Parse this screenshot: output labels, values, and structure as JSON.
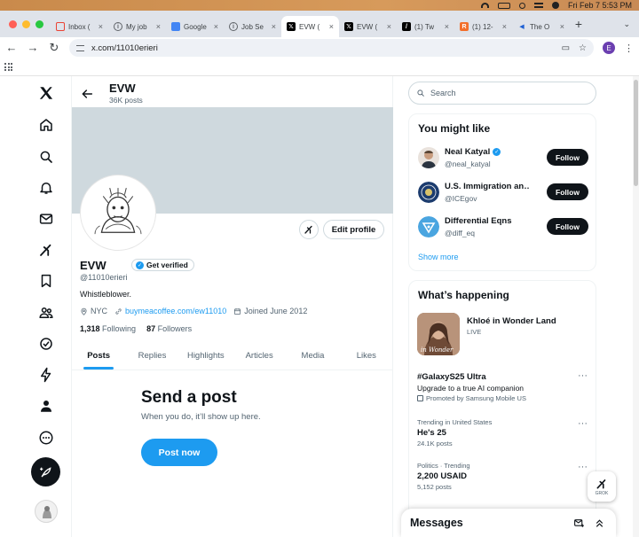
{
  "menubar": {
    "datetime": "Fri Feb 7  5:53 PM"
  },
  "browser": {
    "tabs": [
      {
        "label": "Inbox (",
        "favicon": "gmail-icon"
      },
      {
        "label": "My job",
        "favicon": "info-icon"
      },
      {
        "label": "Google",
        "favicon": "docs-icon"
      },
      {
        "label": "Job Se",
        "favicon": "info-icon"
      },
      {
        "label": "EVW (",
        "favicon": "x-icon"
      },
      {
        "label": "EVW (",
        "favicon": "x-icon"
      },
      {
        "label": "(1) Tw",
        "favicon": "slash-icon"
      },
      {
        "label": "(1) 12-",
        "favicon": "orange-icon"
      },
      {
        "label": "The O",
        "favicon": "blue-icon"
      }
    ],
    "url": "x.com/11010erieri",
    "profile_initial": "E"
  },
  "header": {
    "name": "EVW",
    "posts_count": "36K posts"
  },
  "profile": {
    "edit_label": "Edit profile",
    "display_name": "EVW",
    "get_verified_label": "Get verified",
    "handle": "@11010erieri",
    "bio": "Whistleblower.",
    "location": "NYC",
    "website": "buymeacoffee.com/ew11010",
    "joined": "Joined June 2012",
    "following_count": "1,318",
    "following_label": "Following",
    "followers_count": "87",
    "followers_label": "Followers"
  },
  "profile_tabs": [
    "Posts",
    "Replies",
    "Highlights",
    "Articles",
    "Media",
    "Likes"
  ],
  "empty_state": {
    "title": "Send a post",
    "subtitle": "When you do, it’ll show up here.",
    "button": "Post now"
  },
  "search": {
    "placeholder": "Search"
  },
  "suggestions": {
    "title": "You might like",
    "items": [
      {
        "name": "Neal Katyal",
        "handle": "@neal_katyal",
        "button": "Follow"
      },
      {
        "name": "U.S. Immigration an…",
        "handle": "@ICEgov",
        "button": "Follow"
      },
      {
        "name": "Differential Eqns",
        "handle": "@diff_eq",
        "button": "Follow"
      }
    ],
    "show_more": "Show more"
  },
  "happening": {
    "title": "What’s happening",
    "featured": {
      "title": "Khloé in Wonder Land",
      "status": "LIVE",
      "image_text": "in Wonder"
    },
    "trends": [
      {
        "context": "",
        "title": "#GalaxyS25 Ultra",
        "subtitle": "Upgrade to a true AI companion",
        "small": "Promoted by Samsung Mobile US"
      },
      {
        "context": "Trending in United States",
        "title": "He's 25",
        "subtitle": "",
        "small": "24.1K posts"
      },
      {
        "context": "Politics · Trending",
        "title": "2,200 USAID",
        "subtitle": "",
        "small": "5,152 posts"
      }
    ]
  },
  "grok_float_label": "GROK",
  "messages": {
    "title": "Messages"
  }
}
